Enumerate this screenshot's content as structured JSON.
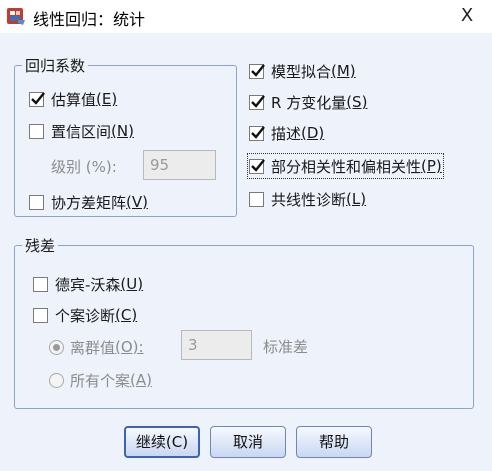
{
  "window": {
    "title": "线性回归：统计",
    "close_glyph": "X"
  },
  "coefficients": {
    "legend": "回归系数",
    "estimates": {
      "label": "估算值",
      "mnemonic": "(E)",
      "checked": true
    },
    "confidence": {
      "label": "置信区间",
      "mnemonic": "(N)",
      "checked": false
    },
    "level_label": "级别 (%):",
    "level_value": "95",
    "covariance": {
      "label": "协方差矩阵",
      "mnemonic": "(V)",
      "checked": false
    }
  },
  "right_options": {
    "model_fit": {
      "label": "模型拟合",
      "mnemonic": "(M)",
      "checked": true
    },
    "r_squared_change": {
      "label": "R 方变化量",
      "mnemonic": "(S)",
      "checked": true
    },
    "descriptives": {
      "label": "描述",
      "mnemonic": "(D)",
      "checked": true
    },
    "part_partial": {
      "label": "部分相关性和偏相关性",
      "mnemonic": "(P)",
      "checked": true
    },
    "collinearity": {
      "label": "共线性诊断",
      "mnemonic": "(L)",
      "checked": false
    }
  },
  "residuals": {
    "legend": "残差",
    "durbin_watson": {
      "label": "德宾-沃森",
      "mnemonic": "(U)",
      "checked": false
    },
    "casewise": {
      "label": "个案诊断",
      "mnemonic": "(C)",
      "checked": false
    },
    "outliers": {
      "label": "离群值",
      "mnemonic": "(O):",
      "selected": true
    },
    "outliers_value": "3",
    "outliers_unit": "标准差",
    "all_cases": {
      "label": "所有个案",
      "mnemonic": "(A)",
      "selected": false
    }
  },
  "buttons": {
    "continue": "继续(C)",
    "cancel": "取消",
    "help": "帮助"
  },
  "colors": {
    "client_bg": "#edf2fb",
    "group_border": "#8ea3c5",
    "button_border": "#6f86b3",
    "check_mark": "#111111"
  }
}
